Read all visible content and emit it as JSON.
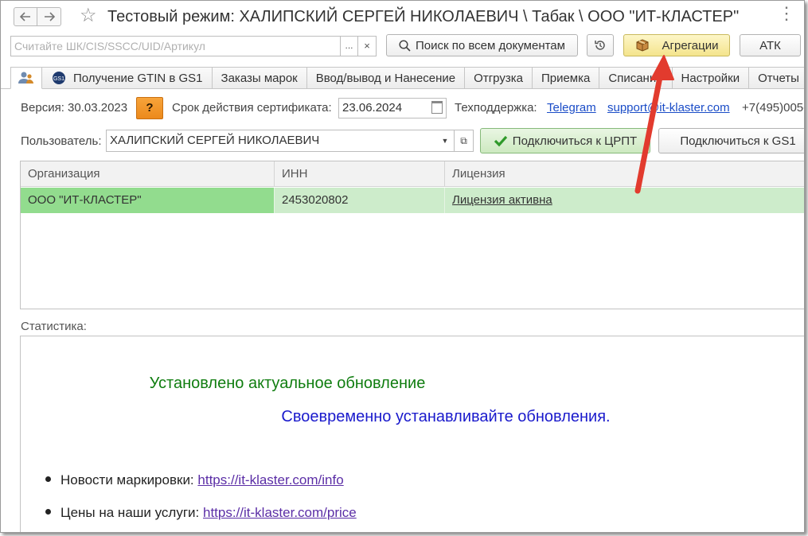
{
  "titlebar": {
    "back_icon": "arrow-left-icon",
    "forward_icon": "arrow-right-icon",
    "favorite_icon": "star-icon",
    "title": "Тестовый режим:  ХАЛИПСКИЙ СЕРГЕЙ НИКОЛАЕВИЧ \\ Табак \\ ООО \"ИТ-КЛАСТЕР\"",
    "more_icon": "more-icon"
  },
  "toolbar": {
    "scan_placeholder": "Считайте ШК/CIS/SSCC/UID/Артикул",
    "scan_value": "",
    "select_icon": "ellipsis-icon",
    "clear_icon": "close-icon",
    "search_label": "Поиск по всем документам",
    "history_icon": "history-icon",
    "aggregation_label": "Агрегации",
    "atk_label": "АТК"
  },
  "tabs": [
    {
      "label": "",
      "icon": "users-icon",
      "active": true
    },
    {
      "label": "Получение GTIN в GS1",
      "icon": "gs1-icon"
    },
    {
      "label": "Заказы марок"
    },
    {
      "label": "Ввод/вывод и Нанесение"
    },
    {
      "label": "Отгрузка"
    },
    {
      "label": "Приемка"
    },
    {
      "label": "Списание"
    },
    {
      "label": "Настройки"
    },
    {
      "label": "Отчеты"
    }
  ],
  "info": {
    "version_label": "Версия: 30.03.2023",
    "help_label": "?",
    "cert_label": "Срок действия сертификата:",
    "cert_date": "23.06.2024",
    "support_label": "Техподдержка:",
    "telegram_link": "Telegram",
    "email_link": "support@it-klaster.com",
    "phone": "+7(495)005-"
  },
  "user": {
    "label": "Пользователь:",
    "value": "ХАЛИПСКИЙ СЕРГЕЙ НИКОЛАЕВИЧ",
    "connect_crpt_label": "Подключиться к ЦРПТ",
    "connect_gs1_label": "Подключиться к GS1"
  },
  "table": {
    "columns": [
      "Организация",
      "ИНН",
      "Лицензия"
    ],
    "rows": [
      {
        "org": "ООО \"ИТ-КЛАСТЕР\"",
        "inn": "2453020802",
        "license": "Лицензия активна"
      }
    ]
  },
  "stats": {
    "label": "Статистика:",
    "update_status": "Установлено актуальное обновление",
    "update_hint": "Своевременно устанавливайте обновления.",
    "bullets": [
      {
        "text": "Новости маркировки: ",
        "link": "https://it-klaster.com/info"
      },
      {
        "text": "Цены на наши услуги: ",
        "link": "https://it-klaster.com/price"
      }
    ]
  },
  "colors": {
    "annotation_arrow": "#e23b2e",
    "selected_row": "#cdeccb",
    "selected_cell": "#92dc8e",
    "update_ok": "#0f7d0f",
    "update_hint": "#1a1acc"
  }
}
